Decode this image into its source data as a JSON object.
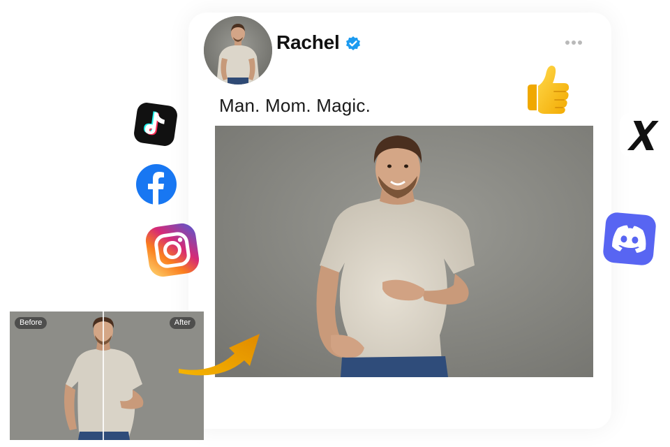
{
  "post": {
    "author": "Rachel",
    "caption": "Man. Mom. Magic."
  },
  "comparison": {
    "before_label": "Before",
    "after_label": "After"
  },
  "icons": {
    "verified": "verified-badge-icon",
    "more": "more-horizontal-icon",
    "reaction": "thumbs-up-icon",
    "arrow": "curved-arrow-icon"
  },
  "social_networks": [
    "TikTok",
    "Facebook",
    "Instagram",
    "X",
    "Discord"
  ],
  "colors": {
    "verified_blue": "#1d9bf0",
    "facebook_blue": "#1877f2",
    "discord_blurple": "#5865f2",
    "arrow_gold": "#f5b400",
    "photo_background": "#8b8b86",
    "shirt": "#d9d3c7"
  }
}
